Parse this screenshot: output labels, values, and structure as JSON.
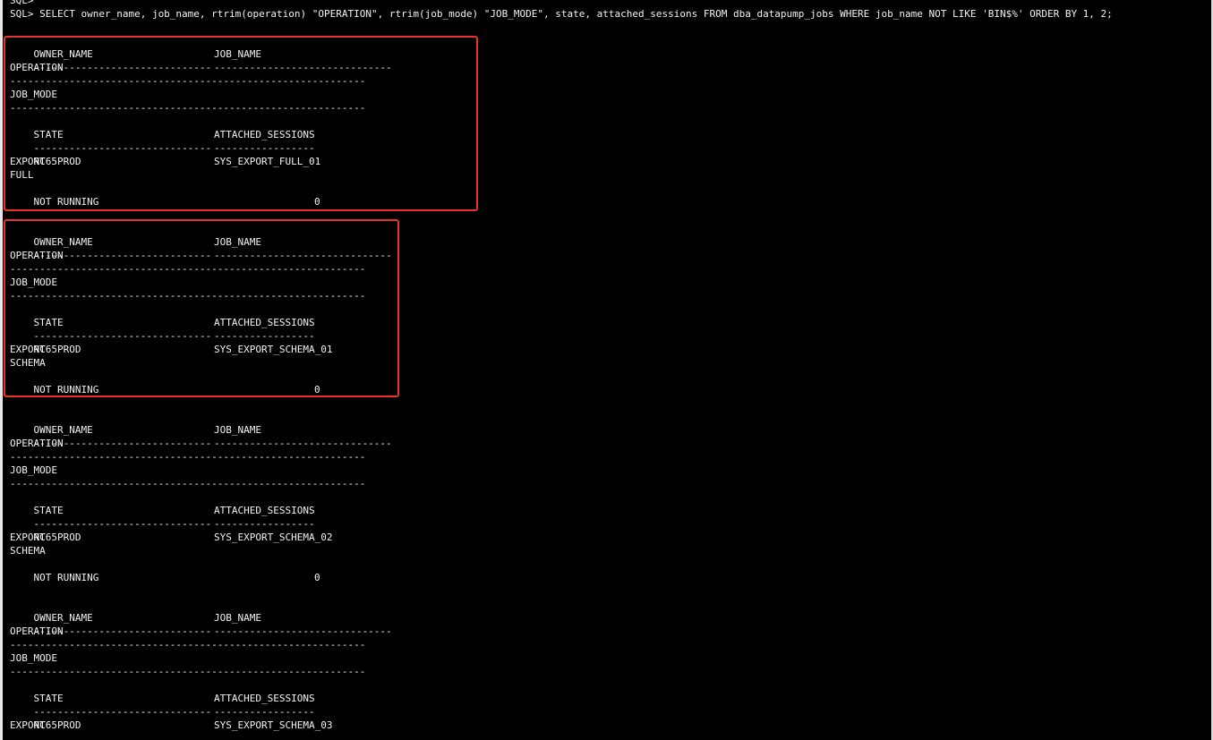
{
  "prompt_top": "SQL>",
  "query": "SQL> SELECT owner_name, job_name, rtrim(operation) \"OPERATION\", rtrim(job_mode) \"JOB_MODE\", state, attached_sessions FROM dba_datapump_jobs WHERE job_name NOT LIKE 'BIN$%' ORDER BY 1, 2;",
  "headers": {
    "owner_name": "OWNER_NAME",
    "job_name": "JOB_NAME",
    "operation": "OPERATION",
    "job_mode": "JOB_MODE",
    "state": "STATE",
    "attached_sessions": "ATTACHED_SESSIONS"
  },
  "dashes": {
    "owner": "------------------------------",
    "job": "------------------------------",
    "operation": "------------------------------------------------------------",
    "job_mode": "------------------------------------------------------------",
    "state": "------------------------------",
    "attached": "-----------------"
  },
  "records": [
    {
      "owner_name": "NC65PROD",
      "job_name": "SYS_EXPORT_FULL_01",
      "operation": "EXPORT",
      "job_mode": "FULL",
      "state": "NOT RUNNING",
      "attached_sessions": "0"
    },
    {
      "owner_name": "NC65PROD",
      "job_name": "SYS_EXPORT_SCHEMA_01",
      "operation": "EXPORT",
      "job_mode": "SCHEMA",
      "state": "NOT RUNNING",
      "attached_sessions": "0"
    },
    {
      "owner_name": "NC65PROD",
      "job_name": "SYS_EXPORT_SCHEMA_02",
      "operation": "EXPORT",
      "job_mode": "SCHEMA",
      "state": "NOT RUNNING",
      "attached_sessions": "0"
    },
    {
      "owner_name": "NC65PROD",
      "job_name": "SYS_EXPORT_SCHEMA_03",
      "operation": "EXPORT"
    }
  ],
  "colors": {
    "background": "#000000",
    "text": "#f2f2f2",
    "highlight": "#e8322e"
  }
}
